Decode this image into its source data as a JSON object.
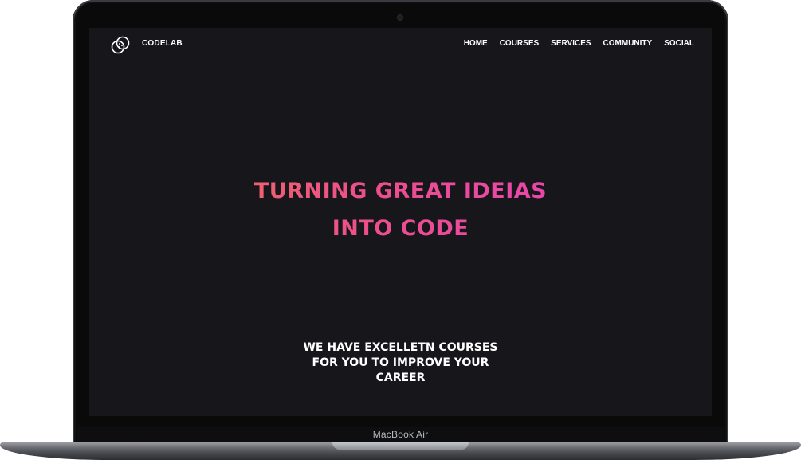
{
  "device": {
    "model_label": "MacBook Air"
  },
  "site": {
    "brand": "CODELAB",
    "logo_icon": "double-circle-dots-icon",
    "nav": [
      {
        "label": "HOME"
      },
      {
        "label": "COURSES"
      },
      {
        "label": "SERVICES"
      },
      {
        "label": "COMMUNITY"
      },
      {
        "label": "SOCIAL"
      }
    ],
    "hero": {
      "line1": "TURNING GREAT IDEIAS",
      "line2": "INTO CODE",
      "gradient": [
        "#f07a48",
        "#ec4f8c",
        "#e63ec6"
      ]
    },
    "subheading": {
      "line1": "WE HAVE EXCELLETN COURSES",
      "line2": "FOR YOU TO IMPROVE YOUR",
      "line3": "CAREER"
    },
    "colors": {
      "background": "#17171b",
      "text": "#ffffff"
    }
  }
}
